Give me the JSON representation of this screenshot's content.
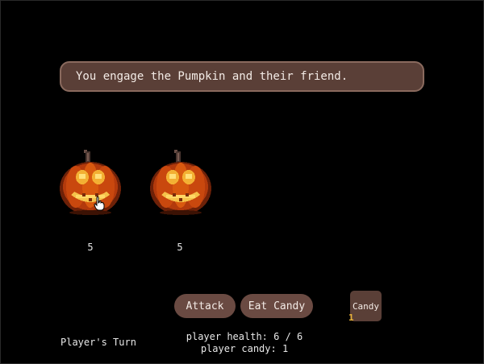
{
  "dialog": {
    "text": "You engage the Pumpkin and their friend."
  },
  "enemies": [
    {
      "name": "Pumpkin",
      "hp": "5"
    },
    {
      "name": "friend",
      "hp": "5"
    }
  ],
  "actions": {
    "attack_label": "Attack",
    "eat_candy_label": "Eat Candy"
  },
  "inventory": {
    "candy_label": "Candy",
    "candy_count": "1"
  },
  "status": {
    "turn_text": "Player's Turn",
    "health_text": "player health: 6 / 6",
    "candy_text": "player candy: 1"
  },
  "icons": {
    "enemy_sprite": "jack-o-lantern-icon",
    "cursor": "hand-pointer-icon"
  },
  "colors": {
    "background": "#000000",
    "panel": "#5a3f37",
    "button": "#6a4a42",
    "accent": "#e8b23a"
  }
}
